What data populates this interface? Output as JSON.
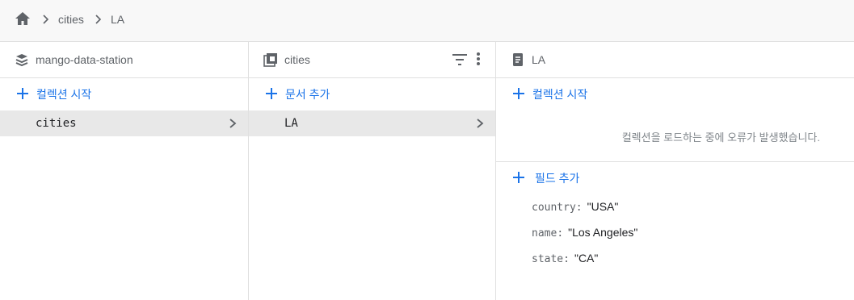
{
  "breadcrumb": {
    "home_icon": "home-icon",
    "items": [
      "cities",
      "LA"
    ]
  },
  "panels": {
    "root": {
      "icon": "database-icon",
      "title": "mango-data-station",
      "add_label": "컬렉션 시작",
      "selected_item": "cities"
    },
    "collection": {
      "icon": "collection-icon",
      "title": "cities",
      "add_label": "문서 추가",
      "selected_item": "LA"
    },
    "document": {
      "icon": "document-icon",
      "title": "LA",
      "add_collection_label": "컬렉션 시작",
      "error_message": "컬렉션을 로드하는 중에 오류가 발생했습니다.",
      "add_field_label": "필드 추가",
      "fields": [
        {
          "key": "country",
          "value": "\"USA\""
        },
        {
          "key": "name",
          "value": "\"Los Angeles\""
        },
        {
          "key": "state",
          "value": "\"CA\""
        }
      ]
    }
  },
  "colors": {
    "accent": "#1a73e8",
    "selected_bg": "#e8e8e8",
    "border": "#e0e0e0"
  }
}
